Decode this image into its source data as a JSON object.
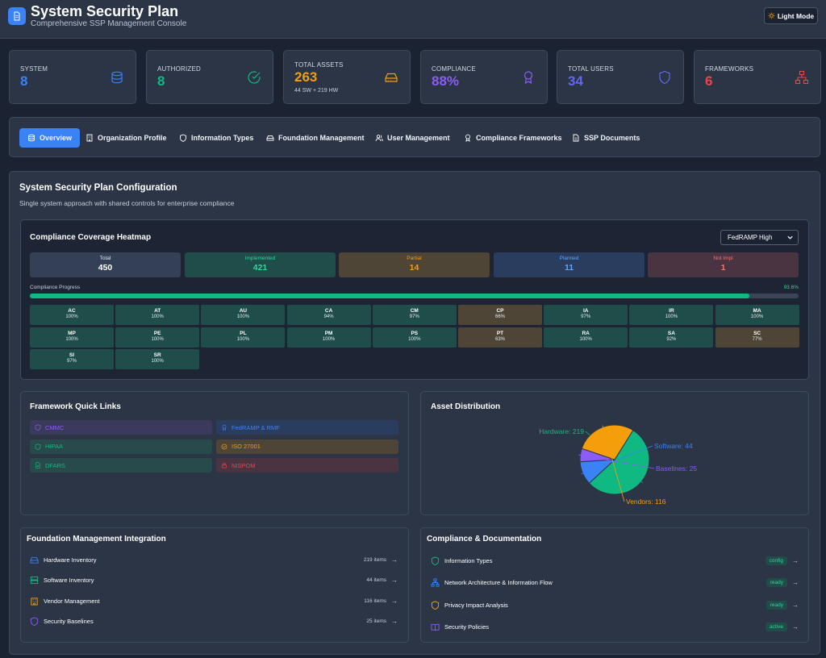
{
  "header": {
    "title": "System Security Plan",
    "subtitle": "Comprehensive SSP Management Console",
    "light_mode_label": "Light Mode"
  },
  "stats": [
    {
      "label": "SYSTEM",
      "value": "8",
      "color": "#3b82f6",
      "icon": "database-icon"
    },
    {
      "label": "AUTHORIZED",
      "value": "8",
      "color": "#10b981",
      "icon": "check-circle-icon"
    },
    {
      "label": "TOTAL ASSETS",
      "value": "263",
      "sub": "44 SW + 219 HW",
      "color": "#f59e0b",
      "icon": "hard-drive-icon"
    },
    {
      "label": "COMPLIANCE",
      "value": "88%",
      "color": "#8b5cf6",
      "icon": "award-icon"
    },
    {
      "label": "TOTAL USERS",
      "value": "34",
      "color": "#6366f1",
      "icon": "shield-icon"
    },
    {
      "label": "FRAMEWORKS",
      "value": "6",
      "color": "#ef4444",
      "icon": "network-icon"
    }
  ],
  "tabs": [
    {
      "label": "Overview",
      "active": true
    },
    {
      "label": "Organization Profile"
    },
    {
      "label": "Information Types"
    },
    {
      "label": "Foundation Management"
    },
    {
      "label": "User Management"
    },
    {
      "label": "Compliance Frameworks"
    },
    {
      "label": "SSP Documents"
    }
  ],
  "main": {
    "title": "System Security Plan Configuration",
    "description": "Single system approach with shared controls for enterprise compliance"
  },
  "heatmap": {
    "title": "Compliance Coverage Heatmap",
    "selected_framework": "FedRAMP High",
    "summary": [
      {
        "label": "Total",
        "value": "450"
      },
      {
        "label": "Implemented",
        "value": "421"
      },
      {
        "label": "Partial",
        "value": "14"
      },
      {
        "label": "Planned",
        "value": "11"
      },
      {
        "label": "Not Impl",
        "value": "1"
      }
    ],
    "progress_label": "Compliance Progress",
    "progress_pct": "93.6%",
    "progress_value": 93.6,
    "families": [
      {
        "code": "AC",
        "pct": "100%",
        "status": "g"
      },
      {
        "code": "AT",
        "pct": "100%",
        "status": "g"
      },
      {
        "code": "AU",
        "pct": "100%",
        "status": "g"
      },
      {
        "code": "CA",
        "pct": "94%",
        "status": "g"
      },
      {
        "code": "CM",
        "pct": "97%",
        "status": "g"
      },
      {
        "code": "CP",
        "pct": "66%",
        "status": "y"
      },
      {
        "code": "IA",
        "pct": "97%",
        "status": "g"
      },
      {
        "code": "IR",
        "pct": "100%",
        "status": "g"
      },
      {
        "code": "MA",
        "pct": "100%",
        "status": "g"
      },
      {
        "code": "MP",
        "pct": "100%",
        "status": "g"
      },
      {
        "code": "PE",
        "pct": "100%",
        "status": "g"
      },
      {
        "code": "PL",
        "pct": "100%",
        "status": "g"
      },
      {
        "code": "PM",
        "pct": "100%",
        "status": "g"
      },
      {
        "code": "PS",
        "pct": "100%",
        "status": "g"
      },
      {
        "code": "PT",
        "pct": "63%",
        "status": "y"
      },
      {
        "code": "RA",
        "pct": "100%",
        "status": "g"
      },
      {
        "code": "SA",
        "pct": "92%",
        "status": "g"
      },
      {
        "code": "SC",
        "pct": "77%",
        "status": "y"
      },
      {
        "code": "SI",
        "pct": "97%",
        "status": "g"
      },
      {
        "code": "SR",
        "pct": "100%",
        "status": "g"
      }
    ]
  },
  "quick_links": {
    "title": "Framework Quick Links",
    "items": [
      {
        "label": "CMMC",
        "color": "#8b5cf6",
        "bg": "#3b3a5c",
        "icon": "shield-icon"
      },
      {
        "label": "FedRAMP & RMF",
        "color": "#3b82f6",
        "bg": "#2a3d5e",
        "icon": "award-icon"
      },
      {
        "label": "HIPAA",
        "color": "#10b981",
        "bg": "#284a4b",
        "icon": "shield-icon"
      },
      {
        "label": "ISO 27001",
        "color": "#f59e0b",
        "bg": "#4e4536",
        "icon": "check-circle-icon"
      },
      {
        "label": "DFARS",
        "color": "#10b981",
        "bg": "#284a4b",
        "icon": "file-icon"
      },
      {
        "label": "NISPOM",
        "color": "#ef4444",
        "bg": "#4a3441",
        "icon": "lock-icon"
      }
    ]
  },
  "asset_distribution": {
    "title": "Asset Distribution"
  },
  "chart_data": {
    "type": "pie",
    "title": "Asset Distribution",
    "slices": [
      {
        "label": "Hardware: 219",
        "name": "Hardware",
        "value": 219,
        "color": "#10b981"
      },
      {
        "label": "Software: 44",
        "name": "Software",
        "value": 44,
        "color": "#3b82f6"
      },
      {
        "label": "Baselines: 25",
        "name": "Baselines",
        "value": 25,
        "color": "#8b5cf6"
      },
      {
        "label": "Vendors: 116",
        "name": "Vendors",
        "value": 116,
        "color": "#f59e0b"
      }
    ]
  },
  "foundation": {
    "title": "Foundation Management Integration",
    "items": [
      {
        "label": "Hardware Inventory",
        "count": "219 items",
        "color": "#3b82f6",
        "icon": "hard-drive-icon"
      },
      {
        "label": "Software Inventory",
        "count": "44 items",
        "color": "#10b981",
        "icon": "server-icon"
      },
      {
        "label": "Vendor Management",
        "count": "116 items",
        "color": "#f59e0b",
        "icon": "building-icon"
      },
      {
        "label": "Security Baselines",
        "count": "25 items",
        "color": "#8b5cf6",
        "icon": "shield-icon"
      }
    ]
  },
  "documentation": {
    "title": "Compliance & Documentation",
    "items": [
      {
        "label": "Information Types",
        "badge": "config",
        "color": "#10b981",
        "icon": "shield-icon"
      },
      {
        "label": "Network Architecture & Information Flow",
        "badge": "ready",
        "color": "#3b82f6",
        "icon": "network-icon"
      },
      {
        "label": "Privacy Impact Analysis",
        "badge": "ready",
        "color": "#f59e0b",
        "icon": "shield-icon"
      },
      {
        "label": "Security Policies",
        "badge": "active",
        "color": "#8b5cf6",
        "icon": "book-icon"
      }
    ]
  }
}
